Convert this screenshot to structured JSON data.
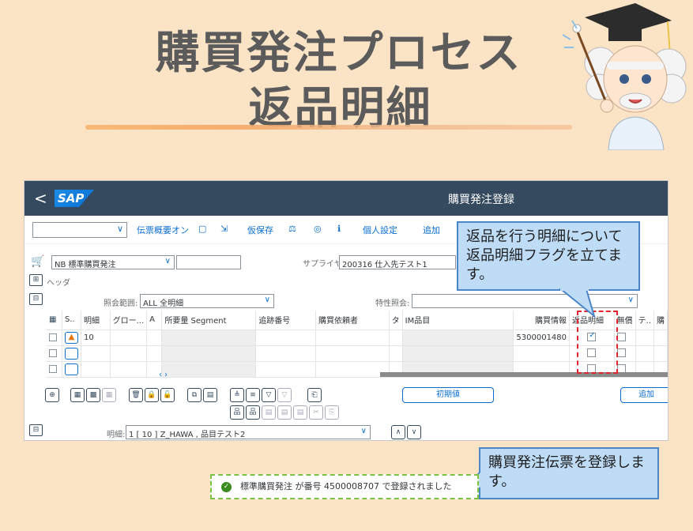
{
  "banner": {
    "line1": "購買発注プロセス",
    "line2": "返品明細"
  },
  "shell": {
    "back": "<",
    "logo": "SAP",
    "title": "購買発注登録"
  },
  "toolbar": {
    "items": [
      "伝票概要オン",
      "仮保存",
      "個人設定",
      "追加"
    ],
    "select_chev": "∨"
  },
  "header": {
    "doc_type": "NB 標準購買発注",
    "header_label": "ヘッダ",
    "supplier_label": "サプライヤ:",
    "supplier_value": "200316 仕入先テスト1"
  },
  "items": {
    "scope_label": "照会範囲:",
    "scope_value": "ALL 全明細",
    "feature_label": "特性照会:",
    "columns": [
      "S..",
      "明細",
      "グロー...",
      "A",
      "所要量 Segment",
      "追跡番号",
      "購買依頼者",
      "タ",
      "IM品目",
      "購買情報",
      "返品明細",
      "無償",
      "テ..",
      "購"
    ],
    "rows": [
      {
        "item": "10",
        "info": "5300001480",
        "return": true,
        "free": false
      },
      {
        "item": "",
        "info": "",
        "return": false,
        "free": false
      },
      {
        "item": "",
        "info": "",
        "return": false,
        "free": false
      }
    ],
    "initial_button": "初期値",
    "add_button": "追加"
  },
  "detail": {
    "label": "明細:",
    "value": "1 [ 10 ] Z_HAWA , 品目テスト2"
  },
  "callouts": {
    "return_flag": "返品を行う明細について返品明細フラグを立てます。",
    "register": "購買発注伝票を登録します。"
  },
  "message": {
    "text": "標準購買発注 が番号 4500008707 で登録されました"
  },
  "colors": {
    "shell": "#354a5f",
    "accent": "#0a6ed1",
    "background": "#fbe3c6",
    "callout": "#bfdcf7"
  }
}
